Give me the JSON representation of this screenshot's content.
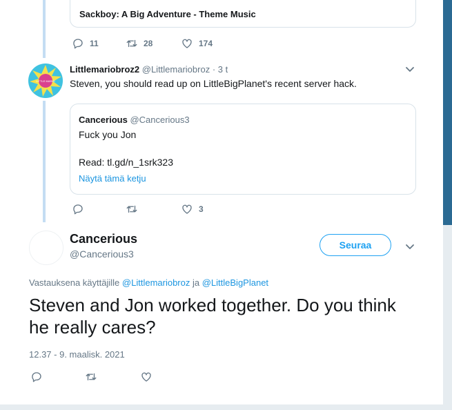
{
  "top_card": {
    "title": "Sackboy: A Big Adventure - Theme Music"
  },
  "tweet1_actions": {
    "replies": "11",
    "retweets": "28",
    "likes": "174"
  },
  "reply_tweet": {
    "display_name": "Littlemariobroz2",
    "handle": "@Littlemariobroz",
    "time": "· 3 t",
    "text": "Steven, you should read up on LittleBigPlanet's recent server hack.",
    "avatar_label": "LITTLE MARIO",
    "quote": {
      "display_name": "Cancerious",
      "handle": "@Cancerious3",
      "line1": "Fuck you Jon",
      "line2": "Read: tl.gd/n_1srk323",
      "show_thread": "Näytä tämä ketju"
    },
    "actions": {
      "replies": "",
      "retweets": "",
      "likes": "3"
    }
  },
  "main_tweet": {
    "display_name": "Cancerious",
    "handle": "@Cancerious3",
    "follow_label": "Seuraa",
    "reply_prefix": "Vastauksena käyttäjille",
    "reply_user1": "@Littlemariobroz",
    "reply_and": "ja",
    "reply_user2": "@LittleBigPlanet",
    "text": "Steven and Jon worked together. Do you think he really cares?",
    "timestamp": "12.37 - 9. maalisk. 2021"
  },
  "colors": {
    "accent": "#1da1f2",
    "thread_line": "#c4ddf3",
    "muted": "#657786",
    "background": "#2b6a93"
  }
}
